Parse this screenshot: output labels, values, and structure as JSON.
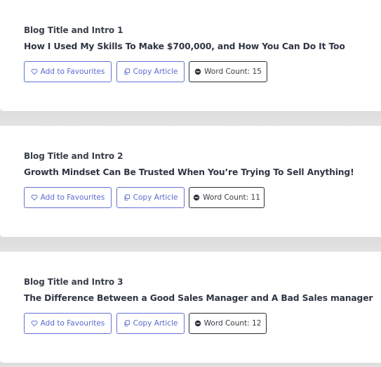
{
  "articles": [
    {
      "label": "Blog Title and Intro 1",
      "title": "How I Used My Skills To Make $700,000, and How You Can Do It Too",
      "favourite_label": "Add to Favourites",
      "copy_label": "Copy Article",
      "word_count_label": "Word Count: 15"
    },
    {
      "label": "Blog Title and Intro 2",
      "title": "Growth Mindset Can Be Trusted When You’re Trying To Sell Anything!",
      "favourite_label": "Add to Favourites",
      "copy_label": "Copy Article",
      "word_count_label": "Word Count: 11"
    },
    {
      "label": "Blog Title and Intro 3",
      "title": "The Difference Between a Good Sales Manager and A Bad Sales manager",
      "favourite_label": "Add to Favourites",
      "copy_label": "Copy Article",
      "word_count_label": "Word Count: 12"
    }
  ],
  "icons": {
    "favourite": "heart-icon",
    "copy": "copy-icon",
    "word_count": "minus-circle-icon"
  },
  "colors": {
    "accent": "#5a6ad0",
    "text": "#303544",
    "background": "#e6e6e6"
  }
}
